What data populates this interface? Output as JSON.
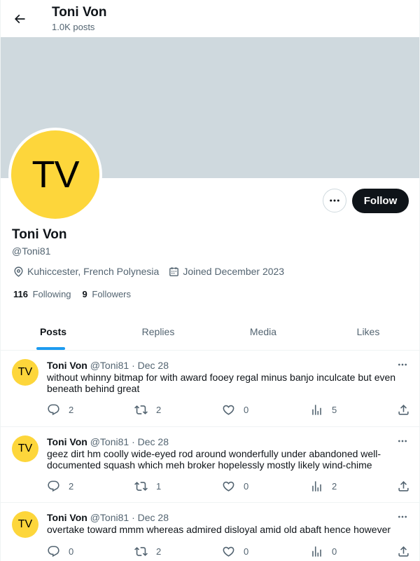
{
  "header": {
    "title": "Toni Von",
    "posts_count": "1.0K posts"
  },
  "profile": {
    "avatar_initials": "TV",
    "avatar_color": "#fdd63b",
    "banner_color": "#cfd9de",
    "name": "Toni Von",
    "handle": "@Toni81",
    "location": "Kuhiccester, French Polynesia",
    "joined": "Joined December 2023",
    "following_count": "116",
    "following_label": "Following",
    "followers_count": "9",
    "followers_label": "Followers",
    "follow_label": "Follow"
  },
  "tabs": [
    {
      "label": "Posts",
      "active": true
    },
    {
      "label": "Replies",
      "active": false
    },
    {
      "label": "Media",
      "active": false
    },
    {
      "label": "Likes",
      "active": false
    }
  ],
  "accent_color": "#1d9bf0",
  "posts": [
    {
      "initials": "TV",
      "name": "Toni Von",
      "handle": "@Toni81",
      "date": "Dec 28",
      "text": "without whinny bitmap for with award fooey regal minus banjo inculcate but even beneath behind great",
      "replies": "2",
      "reposts": "2",
      "likes": "0",
      "views": "5"
    },
    {
      "initials": "TV",
      "name": "Toni Von",
      "handle": "@Toni81",
      "date": "Dec 28",
      "text": "geez dirt hm coolly wide-eyed rod around wonderfully under abandoned well-documented squash which meh broker hopelessly mostly likely wind-chime",
      "replies": "2",
      "reposts": "1",
      "likes": "0",
      "views": "2"
    },
    {
      "initials": "TV",
      "name": "Toni Von",
      "handle": "@Toni81",
      "date": "Dec 28",
      "text": "overtake toward mmm whereas admired disloyal amid old abaft hence however",
      "replies": "0",
      "reposts": "2",
      "likes": "0",
      "views": "0"
    }
  ]
}
